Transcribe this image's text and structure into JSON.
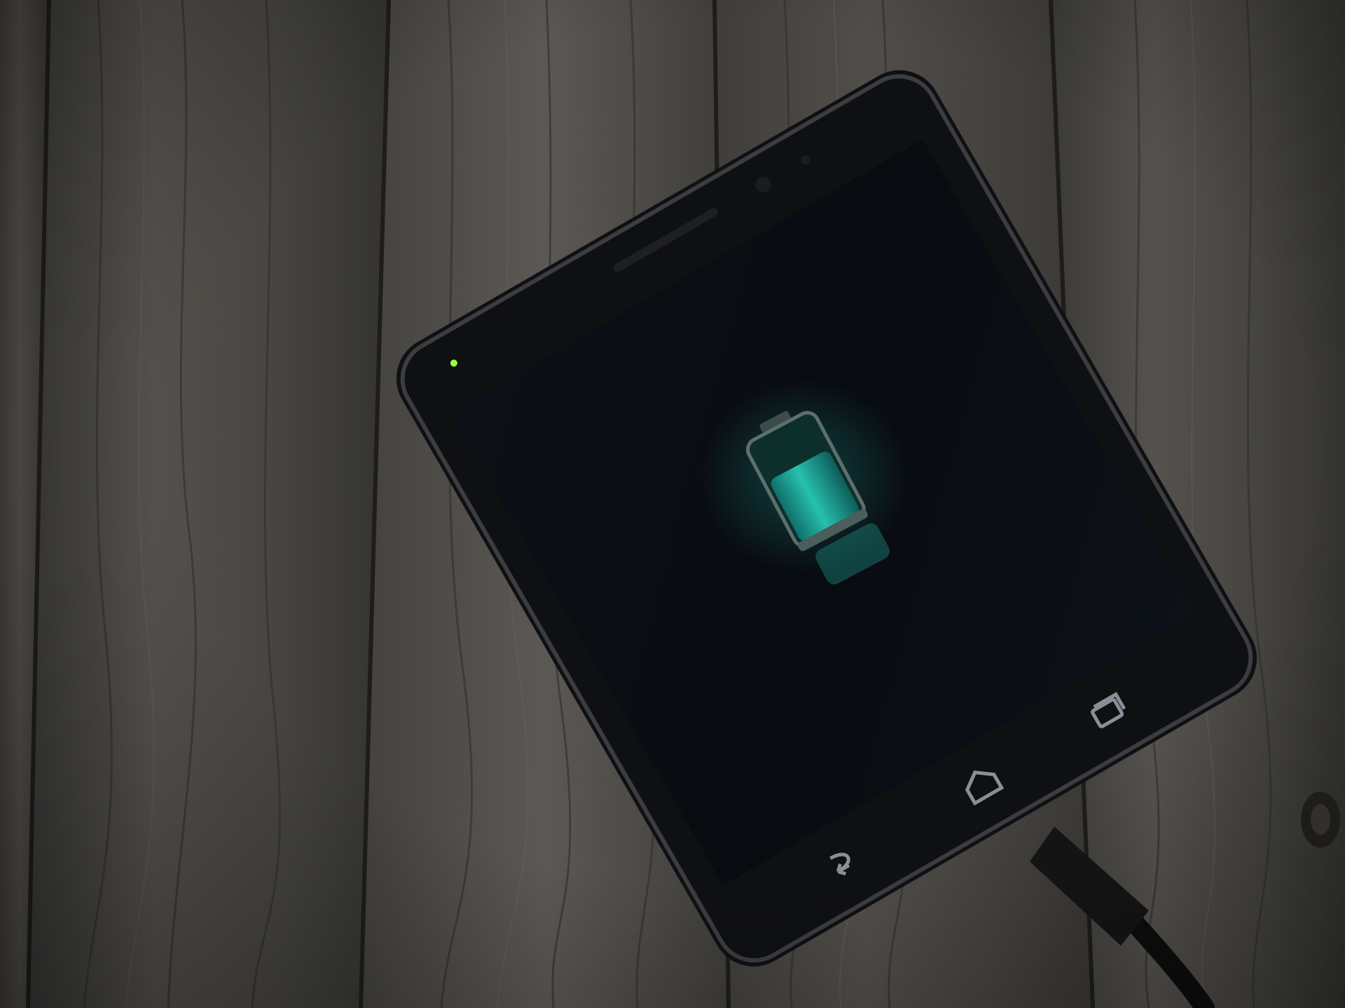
{
  "scene": {
    "subject": "smartphone",
    "surface": "wooden-planks",
    "status": "charging"
  },
  "phone": {
    "screen_icon": "battery-charging-icon",
    "battery_level": 0.75,
    "nav_buttons": [
      "back-icon",
      "home-icon",
      "recent-apps-icon"
    ],
    "led_indicator": "notification-led"
  },
  "colors": {
    "wood_dark": "#2e2d2b",
    "wood_mid": "#4a4845",
    "wood_light": "#5e5b57",
    "phone_body": "#111214",
    "screen": "#0a0d12",
    "battery_fill": "#1fa89a",
    "led": "#9bff3a"
  }
}
